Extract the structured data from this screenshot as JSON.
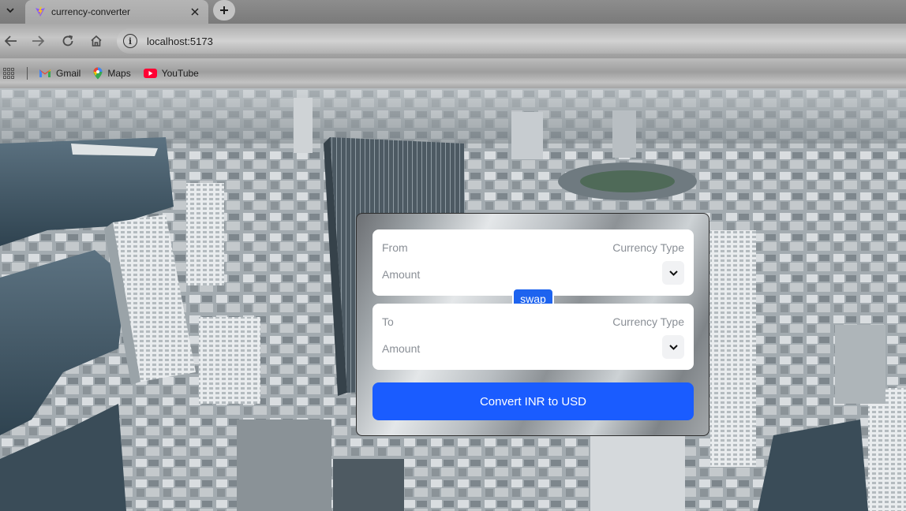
{
  "browser": {
    "tab": {
      "title": "currency-converter"
    },
    "address_bar": {
      "url": "localhost:5173"
    },
    "bookmarks": [
      {
        "label": "Gmail",
        "icon": "gmail-icon"
      },
      {
        "label": "Maps",
        "icon": "maps-icon"
      },
      {
        "label": "YouTube",
        "icon": "youtube-icon"
      }
    ]
  },
  "converter": {
    "from": {
      "label": "From",
      "type_label": "Currency Type",
      "amount_placeholder": "Amount"
    },
    "swap_label": "swap",
    "to": {
      "label": "To",
      "type_label": "Currency Type",
      "amount_placeholder": "Amount"
    },
    "convert_label": "Convert INR to USD"
  },
  "colors": {
    "primary_button": "#1a5cff",
    "swap_button": "#1d63ef",
    "field_background": "#ffffff",
    "muted_text": "#8a8f96"
  }
}
